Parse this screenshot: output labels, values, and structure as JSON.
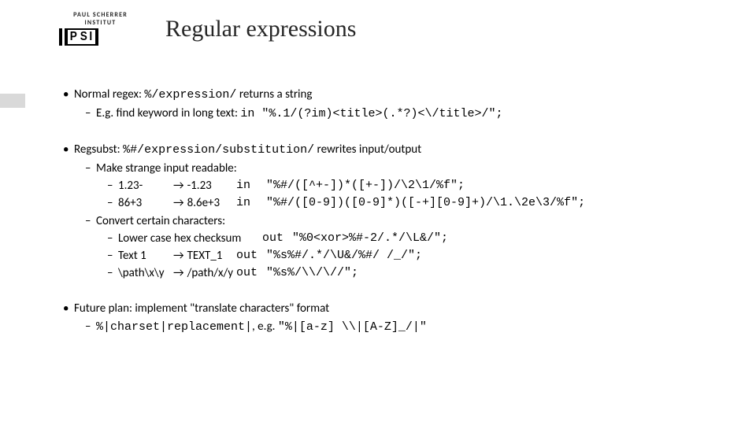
{
  "logo": {
    "top": "PAUL SCHERRER INSTITUT",
    "letters": "PSI"
  },
  "title": "Regular expressions",
  "b1": {
    "lead": "Normal regex: ",
    "code": "%/expression/",
    "tail": "  returns a string",
    "sub_lead": "E.g. find keyword in long text: ",
    "sub_code": "in \"%.1/(?im)<title>(.*?)<\\/title>/\";"
  },
  "b2": {
    "lead": "Regsubst: ",
    "code": "%#/expression/substitution/",
    "tail": "  rewrites input/output",
    "s1": "Make strange input readable:",
    "r1a": "1.23-",
    "r1b": "-1.23",
    "r1dir": "in",
    "r1c": "\"%#/([^+-])*([+-])/\\2\\1/%f\";",
    "r2a": "86+3",
    "r2b": "8.6e+3",
    "r2dir": "in",
    "r2c": "\"%#/([0-9])([0-9]*)([-+][0-9]+)/\\1.\\2e\\3/%f\";",
    "s2": "Convert certain characters:",
    "r3a": "Lower case hex checksum",
    "r3dir": "out",
    "r3c": "\"%0<xor>%#-2/.*/\\L&/\";",
    "r4a": "Text 1",
    "r4b": "TEXT_1",
    "r4dir": "out",
    "r4c": "\"%s%#/.*/\\U&/%#/ /_/\";",
    "r5a": "\\path\\x\\y",
    "r5b": "/path/x/y",
    "r5dir": "out",
    "r5c": "\"%s%/\\\\/\\//\";"
  },
  "b3": {
    "lead": "Future plan: implement \"translate characters\" format",
    "sub_code1": "%|charset|replacement|",
    "sub_mid": ", e.g. ",
    "sub_code2": "\"%|[a-z] \\\\|[A-Z]_/|\""
  }
}
